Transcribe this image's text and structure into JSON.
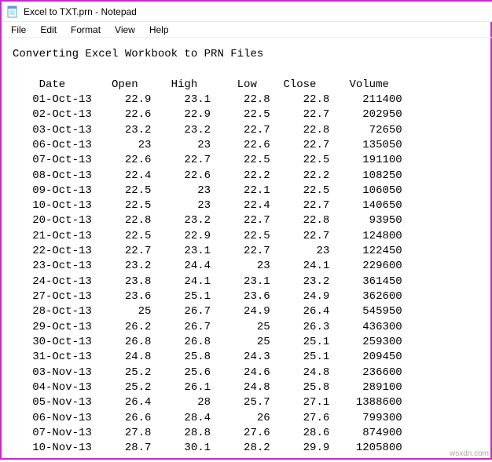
{
  "window": {
    "title": "Excel to TXT.prn - Notepad"
  },
  "menu": {
    "file": "File",
    "edit": "Edit",
    "format": "Format",
    "view": "View",
    "help": "Help"
  },
  "doc": {
    "heading": "Converting Excel Workbook to PRN Files",
    "columns": [
      "Date",
      "Open",
      "High",
      "Low",
      "Close",
      "Volume"
    ],
    "rows": [
      {
        "date": "01-Oct-13",
        "open": "22.9",
        "high": "23.1",
        "low": "22.8",
        "close": "22.8",
        "volume": "211400"
      },
      {
        "date": "02-Oct-13",
        "open": "22.6",
        "high": "22.9",
        "low": "22.5",
        "close": "22.7",
        "volume": "202950"
      },
      {
        "date": "03-Oct-13",
        "open": "23.2",
        "high": "23.2",
        "low": "22.7",
        "close": "22.8",
        "volume": "72650"
      },
      {
        "date": "06-Oct-13",
        "open": "23",
        "high": "23",
        "low": "22.6",
        "close": "22.7",
        "volume": "135050"
      },
      {
        "date": "07-Oct-13",
        "open": "22.6",
        "high": "22.7",
        "low": "22.5",
        "close": "22.5",
        "volume": "191100"
      },
      {
        "date": "08-Oct-13",
        "open": "22.4",
        "high": "22.6",
        "low": "22.2",
        "close": "22.2",
        "volume": "108250"
      },
      {
        "date": "09-Oct-13",
        "open": "22.5",
        "high": "23",
        "low": "22.1",
        "close": "22.5",
        "volume": "106050"
      },
      {
        "date": "10-Oct-13",
        "open": "22.5",
        "high": "23",
        "low": "22.4",
        "close": "22.7",
        "volume": "140650"
      },
      {
        "date": "20-Oct-13",
        "open": "22.8",
        "high": "23.2",
        "low": "22.7",
        "close": "22.8",
        "volume": "93950"
      },
      {
        "date": "21-Oct-13",
        "open": "22.5",
        "high": "22.9",
        "low": "22.5",
        "close": "22.7",
        "volume": "124800"
      },
      {
        "date": "22-Oct-13",
        "open": "22.7",
        "high": "23.1",
        "low": "22.7",
        "close": "23",
        "volume": "122450"
      },
      {
        "date": "23-Oct-13",
        "open": "23.2",
        "high": "24.4",
        "low": "23",
        "close": "24.1",
        "volume": "229600"
      },
      {
        "date": "24-Oct-13",
        "open": "23.8",
        "high": "24.1",
        "low": "23.1",
        "close": "23.2",
        "volume": "361450"
      },
      {
        "date": "27-Oct-13",
        "open": "23.6",
        "high": "25.1",
        "low": "23.6",
        "close": "24.9",
        "volume": "362600"
      },
      {
        "date": "28-Oct-13",
        "open": "25",
        "high": "26.7",
        "low": "24.9",
        "close": "26.4",
        "volume": "545950"
      },
      {
        "date": "29-Oct-13",
        "open": "26.2",
        "high": "26.7",
        "low": "25",
        "close": "26.3",
        "volume": "436300"
      },
      {
        "date": "30-Oct-13",
        "open": "26.8",
        "high": "26.8",
        "low": "25",
        "close": "25.1",
        "volume": "259300"
      },
      {
        "date": "31-Oct-13",
        "open": "24.8",
        "high": "25.8",
        "low": "24.3",
        "close": "25.1",
        "volume": "209450"
      },
      {
        "date": "03-Nov-13",
        "open": "25.2",
        "high": "25.6",
        "low": "24.6",
        "close": "24.8",
        "volume": "236600"
      },
      {
        "date": "04-Nov-13",
        "open": "25.2",
        "high": "26.1",
        "low": "24.8",
        "close": "25.8",
        "volume": "289100"
      },
      {
        "date": "05-Nov-13",
        "open": "26.4",
        "high": "28",
        "low": "25.7",
        "close": "27.1",
        "volume": "1388600"
      },
      {
        "date": "06-Nov-13",
        "open": "26.6",
        "high": "28.4",
        "low": "26",
        "close": "27.6",
        "volume": "799300"
      },
      {
        "date": "07-Nov-13",
        "open": "27.8",
        "high": "28.8",
        "low": "27.6",
        "close": "28.6",
        "volume": "874900"
      },
      {
        "date": "10-Nov-13",
        "open": "28.7",
        "high": "30.1",
        "low": "28.2",
        "close": "29.9",
        "volume": "1205800"
      }
    ]
  },
  "watermark": "wsxdn.com"
}
